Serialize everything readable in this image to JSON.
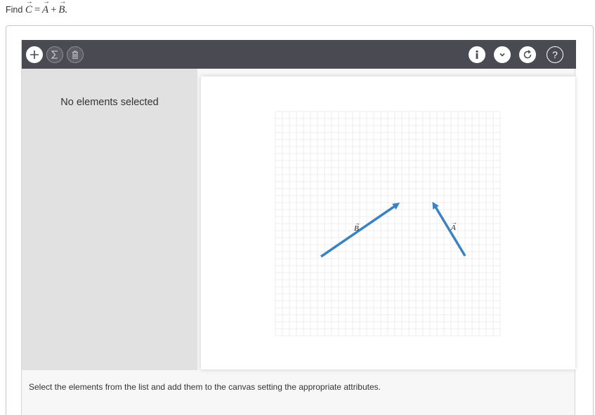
{
  "question": {
    "prefix": "Find",
    "vector_c": "C",
    "equals": "=",
    "vector_a": "A",
    "plus": "+",
    "vector_b": "B",
    "period": "."
  },
  "toolbar": {
    "left_buttons": [
      {
        "name": "add-button",
        "icon": "plus-icon"
      },
      {
        "name": "sum-button",
        "icon": "sigma-icon"
      },
      {
        "name": "delete-button",
        "icon": "trash-icon"
      }
    ],
    "right_buttons": [
      {
        "name": "info-button",
        "icon": "info-icon"
      },
      {
        "name": "collapse-button",
        "icon": "chevron-down-icon"
      },
      {
        "name": "reset-button",
        "icon": "refresh-icon"
      },
      {
        "name": "help-button",
        "icon": "question-icon"
      }
    ]
  },
  "sidebar": {
    "empty_message": "No elements selected"
  },
  "canvas": {
    "grid": true,
    "vectors": [
      {
        "label": "B",
        "color": "#3b82c4"
      },
      {
        "label": "A",
        "color": "#3b82c4"
      }
    ]
  },
  "footer": {
    "instructions": "Select the elements from the list and add them to the canvas setting the appropriate attributes."
  },
  "colors": {
    "toolbar_bg": "#4a4b52",
    "vector": "#3b82c4",
    "sidebar_bg": "#e1e1e1"
  }
}
